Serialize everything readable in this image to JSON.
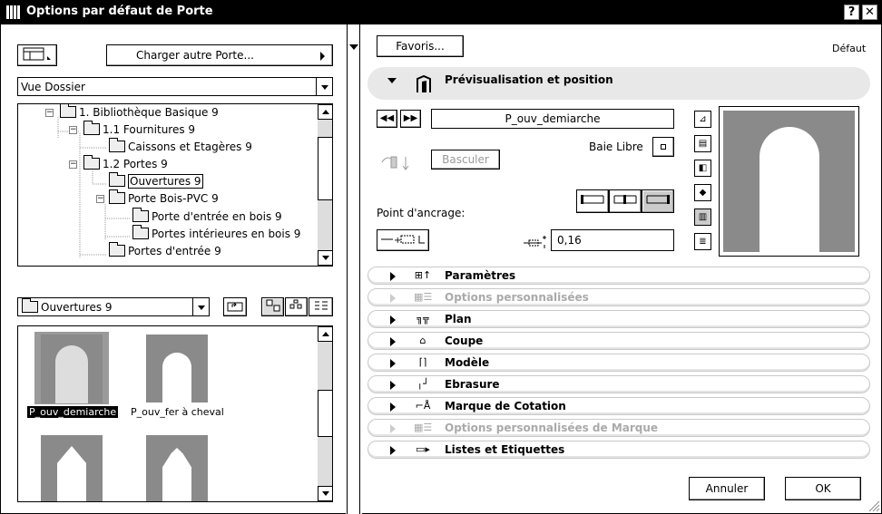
{
  "window": {
    "title": "Options par défaut de Porte",
    "help_label": "?",
    "close_label": "✕"
  },
  "left": {
    "load_other_label": "Charger autre Porte...",
    "view_mode_value": "Vue Dossier",
    "tree": [
      {
        "label": "1. Bibliothèque Basique 9",
        "expander": "−"
      },
      {
        "label": "1.1 Fournitures 9",
        "expander": "−"
      },
      {
        "label": "Caissons et Etagères 9",
        "expander": ""
      },
      {
        "label": "1.2 Portes 9",
        "expander": "−"
      },
      {
        "label": "Ouvertures 9",
        "expander": ""
      },
      {
        "label": "Porte Bois-PVC 9",
        "expander": "−"
      },
      {
        "label": "Porte d'entrée en bois 9",
        "expander": ""
      },
      {
        "label": "Portes intérieures en bois 9",
        "expander": ""
      },
      {
        "label": "Portes d'entrée 9",
        "expander": ""
      }
    ],
    "folder_select_value": "Ouvertures 9",
    "gallery": [
      {
        "label": "P_ouv_demiarche"
      },
      {
        "label": "P_ouv_fer à cheval"
      },
      {
        "label": ""
      },
      {
        "label": ""
      }
    ]
  },
  "right": {
    "favorites_label": "Favoris...",
    "default_label": "Défaut",
    "preview_section_label": "Prévisualisation et position",
    "object_name_value": "P_ouv_demiarche",
    "baie_libre_label": "Baie Libre",
    "basculer_label": "Basculer",
    "anchor_label": "Point d'ancrage:",
    "offset_value": "0,16",
    "sections": [
      {
        "label": "Paramètres",
        "icon": "parameters-icon",
        "disabled": false
      },
      {
        "label": "Options personnalisées",
        "icon": "custom-options-icon",
        "disabled": true
      },
      {
        "label": "Plan",
        "icon": "plan-icon",
        "disabled": false
      },
      {
        "label": "Coupe",
        "icon": "section-icon",
        "disabled": false
      },
      {
        "label": "Modèle",
        "icon": "model-icon",
        "disabled": false
      },
      {
        "label": "Ebrasure",
        "icon": "reveal-icon",
        "disabled": false
      },
      {
        "label": "Marque de Cotation",
        "icon": "dimension-marker-icon",
        "disabled": false
      },
      {
        "label": "Options personnalisées de Marque",
        "icon": "marker-options-icon",
        "disabled": true
      },
      {
        "label": "Listes et Etiquettes",
        "icon": "lists-icon",
        "disabled": false
      }
    ],
    "cancel_label": "Annuler",
    "ok_label": "OK"
  },
  "colors": {
    "titlebar": "#000000",
    "preview_wall": "#8a8a8a",
    "selection": "#000000"
  }
}
